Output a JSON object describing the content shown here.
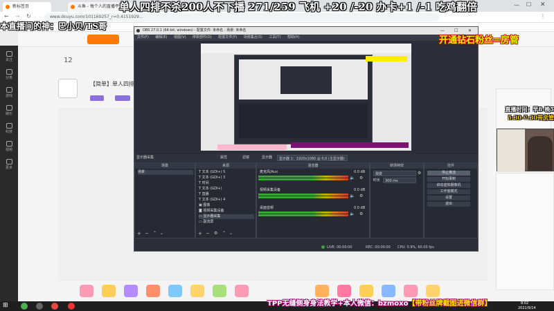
{
  "browser": {
    "tabs": [
      {
        "label": "新标签页"
      },
      {
        "label": "斗鱼 - 每个人的直播平台"
      }
    ],
    "url": "www.douyu.com/101169257_r=0.4151929..."
  },
  "overlay": {
    "title_banner": "单人四排不杀200人不下播 271/259 飞机 +20 /-20 办卡+1 /-1 吃鸡翻倍",
    "god_line": "本直播间的神：巴小贝/TS哥",
    "diamond": "开通钻石粉丝=房管",
    "schedule_l1": "直播时间：早8-晚5",
    "schedule_l2": "5:30-7:30带房管",
    "tpp_prefix": "TPP无缝侧身身法教学+本人微信：bzmoxo",
    "tpp_bracket": "【带粉丝牌截图进微信群】"
  },
  "douyu": {
    "room_title": "【简单】单人四排",
    "follow_count": "12",
    "nav": [
      "关注",
      "分类",
      "游戏",
      "娱乐",
      "科技",
      "视频",
      "更多"
    ]
  },
  "obs": {
    "window_title": "OBS 27.0.1 (64-bit, windows) - 配置文件: 未命名 - 场景: 未命名",
    "menu": "文件(F) 编辑(E) 视图(V) 停靠部件(D) 配置文件(P) 场景集合(S) 工具(T) 帮助(H)",
    "toolbar": {
      "source_label": "显示器采集",
      "props": "属性",
      "filters": "滤镜",
      "display": "显示器",
      "display_value": "显示器 1：1920x1080 @ 0,0 (主显示器)"
    },
    "scenes": {
      "header": "场景",
      "items": [
        "场景"
      ]
    },
    "sources": {
      "header": "来源",
      "items": [
        "文本 (GDI+) 5",
        "文本 (GDI+) 3",
        "时间",
        "文本 (GDI+)",
        "直播",
        "文本 (GDI+) 4",
        "图像",
        "视频采集设备",
        "显示器采集",
        "副流屏"
      ]
    },
    "mixer": {
      "header": "混音器",
      "channels": [
        {
          "name": "麦克风/Aux",
          "db": "0.0 dB"
        },
        {
          "name": "视频采集设备",
          "db": "0.0 dB"
        },
        {
          "name": "桌面音频",
          "db": "0.0 dB"
        }
      ]
    },
    "transitions": {
      "header": "转场特效",
      "type": "渐变",
      "duration_label": "时长",
      "duration": "300 ms"
    },
    "controls": {
      "header": "控件",
      "buttons": [
        "停止推流",
        "开始录制",
        "启动虚拟摄像机",
        "工作室模式",
        "设置",
        "退出"
      ]
    },
    "status": {
      "live": "LIVE: 00:00:00",
      "rec": "REC: 00:00:00",
      "cpu": "CPU: 0.9%, 60.00 fps"
    }
  },
  "taskbar": {
    "time": "8:02",
    "date": "2021/9/14"
  }
}
